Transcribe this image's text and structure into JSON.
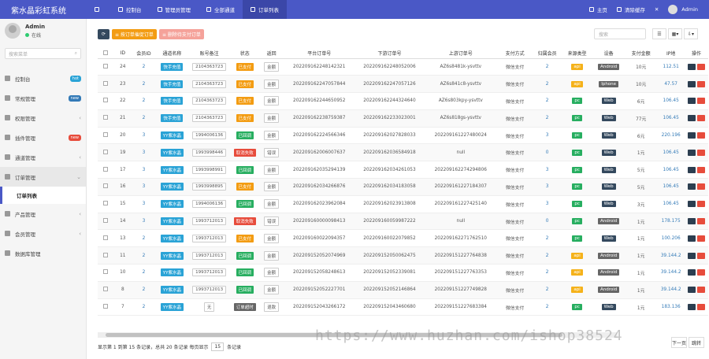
{
  "app_title": "紫水晶彩虹系统",
  "topnav": [
    {
      "label": "控制台"
    },
    {
      "label": "管理员管理"
    },
    {
      "label": "全部通道"
    },
    {
      "label": "订单列表"
    }
  ],
  "topright": {
    "home": "主页",
    "clear_cache": "清除缓存",
    "user": "Admin"
  },
  "user": {
    "name": "Admin",
    "status": "在线"
  },
  "sidebar_search_placeholder": "搜索菜单",
  "sidebar": [
    {
      "label": "控制台",
      "badge": "hot"
    },
    {
      "label": "常规管理",
      "badge": "new"
    },
    {
      "label": "权限管理",
      "badge": ""
    },
    {
      "label": "插件管理",
      "badge": "new"
    },
    {
      "label": "通道管理",
      "badge": ""
    },
    {
      "label": "订单管理",
      "badge": ""
    },
    {
      "label": "订单列表",
      "badge": ""
    },
    {
      "label": "产品管理",
      "badge": ""
    },
    {
      "label": "会员管理",
      "badge": ""
    },
    {
      "label": "数据库管理",
      "badge": ""
    }
  ],
  "toolbar": {
    "btn1": "≡ 按订单催促订单",
    "btn2": "≡ 删除待支付订单",
    "search_placeholder": "搜索"
  },
  "columns": [
    "ID",
    "会员ID",
    "通道名称",
    "账号备注",
    "状态",
    "返回",
    "平台订单号",
    "下游订单号",
    "上游订单号",
    "支付方式",
    "归属会员",
    "来源类型",
    "设备",
    "支付金额",
    "IP地",
    "操作"
  ],
  "rows": [
    [
      "24",
      "2",
      "快手充值",
      "2104363723",
      "已支付",
      "金额",
      "202209162248142321",
      "202209162248052006",
      "AZ6s8481k-ysvttv",
      "微信支付",
      "2",
      "api",
      "Android",
      "10元",
      "112.51"
    ],
    [
      "23",
      "2",
      "快手充值",
      "2104363723",
      "已支付",
      "金额",
      "202209162247057844",
      "202209162247057126",
      "AZ6s841c8-ysvttv",
      "微信支付",
      "2",
      "api",
      "Iphone",
      "10元",
      "47.57"
    ],
    [
      "22",
      "2",
      "快手充值",
      "2104363723",
      "已支付",
      "金额",
      "202209162244650952",
      "202209162244324640",
      "AZ6s803kpy-ysvttv",
      "微信支付",
      "2",
      "pc",
      "Web",
      "6元",
      "106.45"
    ],
    [
      "21",
      "2",
      "快手充值",
      "2104363723",
      "已支付",
      "金额",
      "202209162238759387",
      "202209162233023001",
      "AZ6s818gs-ysvttv",
      "微信支付",
      "2",
      "pc",
      "Web",
      "77元",
      "106.45"
    ],
    [
      "20",
      "3",
      "YY紫水晶",
      "1994006136",
      "已回调",
      "金额",
      "202209162224566346",
      "202209162027828033",
      "202209161227480024",
      "微信支付",
      "3",
      "pc",
      "Web",
      "6元",
      "220.196"
    ],
    [
      "19",
      "3",
      "YY紫水晶",
      "1993998446",
      "取消失败",
      "错误",
      "202209162006007637",
      "202209162036584918",
      "null",
      "微信支付",
      "0",
      "pc",
      "Web",
      "1元",
      "106.45"
    ],
    [
      "17",
      "3",
      "YY紫水晶",
      "1993998991",
      "已回调",
      "金额",
      "202209162035294139",
      "202209162034261053",
      "202209162274294806",
      "微信支付",
      "3",
      "pc",
      "Web",
      "5元",
      "106.45"
    ],
    [
      "16",
      "3",
      "YY紫水晶",
      "1993998895",
      "已支付",
      "金额",
      "202209162034266876",
      "202209162034183058",
      "202209161227184307",
      "微信支付",
      "3",
      "pc",
      "Web",
      "5元",
      "106.45"
    ],
    [
      "15",
      "3",
      "YY紫水晶",
      "1994006136",
      "已回调",
      "金额",
      "202209162023962084",
      "202209162023913808",
      "202209161227425140",
      "微信支付",
      "3",
      "pc",
      "Web",
      "3元",
      "106.45"
    ],
    [
      "14",
      "3",
      "YY紫水晶",
      "1993712013",
      "取消失败",
      "错误",
      "202209160000098413",
      "202209160059987222",
      "null",
      "微信支付",
      "0",
      "pc",
      "Android",
      "1元",
      "178.175"
    ],
    [
      "13",
      "2",
      "YY紫水晶",
      "1993712013",
      "已支付",
      "金额",
      "202209160022094357",
      "202209160022079852",
      "202209162271762510",
      "微信支付",
      "2",
      "pc",
      "Web",
      "1元",
      "100.206"
    ],
    [
      "11",
      "2",
      "YY紫水晶",
      "1993712013",
      "已回调",
      "金额",
      "202209152052074969",
      "202209152050062475",
      "202209151227764838",
      "微信支付",
      "2",
      "api",
      "Android",
      "1元",
      "39.144.2"
    ],
    [
      "10",
      "2",
      "YY紫水晶",
      "1993712013",
      "已回调",
      "金额",
      "202209152058248613",
      "202209152052339081",
      "202209151227763353",
      "微信支付",
      "2",
      "api",
      "Android",
      "1元",
      "39.144.2"
    ],
    [
      "8",
      "2",
      "YY紫水晶",
      "1993712013",
      "已回调",
      "金额",
      "202209152052227701",
      "202209152052146864",
      "202209151227749828",
      "微信支付",
      "2",
      "api",
      "Android",
      "1元",
      "39.144.2"
    ],
    [
      "7",
      "2",
      "YY紫水晶",
      "无",
      "订单超时",
      "退款",
      "202209152043266172",
      "202209152043460680",
      "202209151227683384",
      "微信支付",
      "2",
      "pc",
      "Web",
      "1元",
      "183.136"
    ]
  ],
  "footer": {
    "summary": "显示第 1 到第 15 条记录，总共 20 条记录 每页显示",
    "per_page": "15",
    "suffix": "条记录",
    "next": "下一页",
    "last": "跳转"
  },
  "watermark": "https://www.huzhan.com/ishop38524"
}
